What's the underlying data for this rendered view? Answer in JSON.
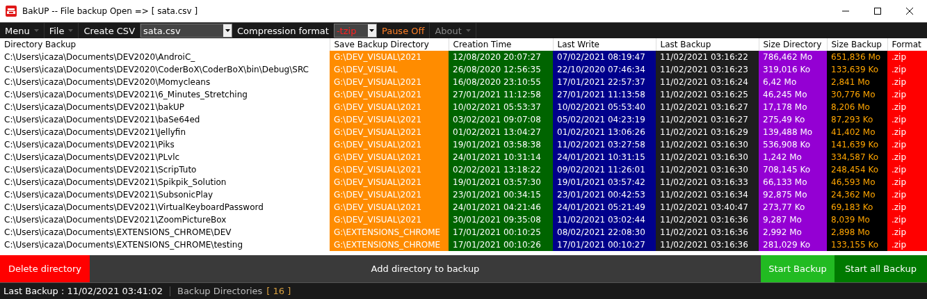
{
  "window": {
    "title": "BakUP -- File backup Open => [ sata.csv ]"
  },
  "toolbar": [
    {
      "kind": "menu",
      "label": "Menu"
    },
    {
      "kind": "menu",
      "label": "File"
    },
    {
      "kind": "button",
      "label": "Create CSV"
    },
    {
      "kind": "dropdown",
      "value": "sata.csv"
    },
    {
      "kind": "label",
      "label": "Compression format"
    },
    {
      "kind": "dropdown-alert",
      "value": "-tzip"
    },
    {
      "kind": "toggle",
      "label": "Pause Off"
    },
    {
      "kind": "menu-disabled",
      "label": "About"
    }
  ],
  "table": {
    "columns": [
      {
        "label": "Directory Backup",
        "color": "#ffffff"
      },
      {
        "label": "Save Backup Directory",
        "color": "#ff8c00"
      },
      {
        "label": "Creation Time",
        "color": "#006400"
      },
      {
        "label": "Last Write",
        "color": "#00008b"
      },
      {
        "label": "Last Backup",
        "color": "#1e1e1e"
      },
      {
        "label": "Size Directory",
        "color": "#9400d3"
      },
      {
        "label": "Size Backup",
        "color": "#000000"
      },
      {
        "label": "Format",
        "color": "#ff0000"
      }
    ],
    "rows": [
      [
        "C:\\Users\\icaza\\Documents\\DEV2020\\AndroiC_",
        "G:\\DEV_VISUAL\\2021",
        "12/08/2020 20:07:27",
        "07/02/2021 08:19:47",
        "11/02/2021 03:16:22",
        "786,462 Mo",
        "651,836 Mo",
        ".zip"
      ],
      [
        "C:\\Users\\icaza\\Documents\\DEV2020\\CoderBoX\\CoderBoX\\bin\\Debug\\SRC",
        "G:\\DEV_VISUAL",
        "26/08/2020 12:56:35",
        "22/10/2020 07:46:34",
        "11/02/2021 03:16:23",
        "319,016 Ko",
        "133,639 Ko",
        ".zip"
      ],
      [
        "C:\\Users\\icaza\\Documents\\DEV2020\\Momycleans",
        "G:\\DEV_VISUAL\\2021",
        "16/08/2020 23:10:55",
        "17/01/2021 22:57:37",
        "11/02/2021 03:16:24",
        "6,42 Mo",
        "2,841 Mo",
        ".zip"
      ],
      [
        "C:\\Users\\icaza\\Documents\\DEV2021\\6_Minutes_Stretching",
        "G:\\DEV_VISUAL\\2021",
        "27/01/2021 11:12:58",
        "27/01/2021 11:13:58",
        "11/02/2021 03:16:25",
        "46,245 Mo",
        "30,776 Mo",
        ".zip"
      ],
      [
        "C:\\Users\\icaza\\Documents\\DEV2021\\bakUP",
        "G:\\DEV_VISUAL\\2021",
        "10/02/2021 05:53:37",
        "10/02/2021 05:53:40",
        "11/02/2021 03:16:27",
        "17,178 Mo",
        "8,206 Mo",
        ".zip"
      ],
      [
        "C:\\Users\\icaza\\Documents\\DEV2021\\baSe64ed",
        "G:\\DEV_VISUAL\\2021",
        "03/02/2021 09:07:08",
        "05/02/2021 04:23:19",
        "11/02/2021 03:16:27",
        "275,49 Ko",
        "87,293 Ko",
        ".zip"
      ],
      [
        "C:\\Users\\icaza\\Documents\\DEV2021\\Jellyfin",
        "G:\\DEV_VISUAL\\2021",
        "01/02/2021 13:04:27",
        "01/02/2021 13:06:26",
        "11/02/2021 03:16:29",
        "139,488 Mo",
        "41,402 Mo",
        ".zip"
      ],
      [
        "C:\\Users\\icaza\\Documents\\DEV2021\\Piks",
        "G:\\DEV_VISUAL\\2021",
        "19/01/2021 03:58:38",
        "11/02/2021 03:27:58",
        "11/02/2021 03:16:30",
        "536,908 Ko",
        "141,639 Ko",
        ".zip"
      ],
      [
        "C:\\Users\\icaza\\Documents\\DEV2021\\PLvlc",
        "G:\\DEV_VISUAL\\2021",
        "24/01/2021 10:31:14",
        "24/01/2021 10:31:15",
        "11/02/2021 03:16:30",
        "1,242 Mo",
        "334,587 Ko",
        ".zip"
      ],
      [
        "C:\\Users\\icaza\\Documents\\DEV2021\\ScripTuto",
        "G:\\DEV_VISUAL\\2021",
        "02/02/2021 13:18:22",
        "09/02/2021 11:26:01",
        "11/02/2021 03:16:30",
        "708,145 Ko",
        "248,454 Ko",
        ".zip"
      ],
      [
        "C:\\Users\\icaza\\Documents\\DEV2021\\Spikpik_Solution",
        "G:\\DEV_VISUAL\\2021",
        "19/01/2021 03:57:30",
        "19/01/2021 03:57:42",
        "11/02/2021 03:16:33",
        "66,133 Mo",
        "46,593 Mo",
        ".zip"
      ],
      [
        "C:\\Users\\icaza\\Documents\\DEV2021\\SubsonicPlay",
        "G:\\DEV_VISUAL\\2021",
        "23/01/2021 00:34:15",
        "23/01/2021 00:42:53",
        "11/02/2021 03:16:34",
        "92,875 Mo",
        "24,362 Mo",
        ".zip"
      ],
      [
        "C:\\Users\\icaza\\Documents\\DEV2021\\VirtualKeyboardPassword",
        "G:\\DEV_VISUAL\\2021",
        "24/01/2021 04:21:46",
        "24/01/2021 05:21:49",
        "11/02/2021 03:40:47",
        "273,77 Ko",
        "69,183 Ko",
        ".zip"
      ],
      [
        "C:\\Users\\icaza\\Documents\\DEV2021\\ZoomPictureBox",
        "G:\\DEV_VISUAL\\2021",
        "30/01/2021 09:35:08",
        "11/02/2021 03:02:44",
        "11/02/2021 03:16:36",
        "9,287 Mo",
        "8,039 Mo",
        ".zip"
      ],
      [
        "C:\\Users\\icaza\\Documents\\EXTENSIONS_CHROME\\DEV",
        "G:\\EXTENSIONS_CHROME",
        "17/01/2021 00:10:25",
        "08/02/2021 22:08:30",
        "11/02/2021 03:16:36",
        "2,992 Mo",
        "2,898 Mo",
        ".zip"
      ],
      [
        "C:\\Users\\icaza\\Documents\\EXTENSIONS_CHROME\\testing",
        "G:\\EXTENSIONS_CHROME",
        "17/01/2021 00:10:26",
        "17/01/2021 00:10:27",
        "11/02/2021 03:16:36",
        "281,029 Ko",
        "133,155 Ko",
        ".zip"
      ]
    ]
  },
  "actions": [
    {
      "kind": "danger",
      "label": "Delete directory"
    },
    {
      "kind": "wide",
      "label": "Add directory to backup"
    },
    {
      "kind": "go",
      "label": "Start Backup"
    },
    {
      "kind": "go-all",
      "label": "Start all Backup"
    }
  ],
  "status_bar": {
    "last_backup": "Last Backup : 11/02/2021 03:41:02",
    "directories": "Backup Directories",
    "count": "[ 16 ]"
  }
}
